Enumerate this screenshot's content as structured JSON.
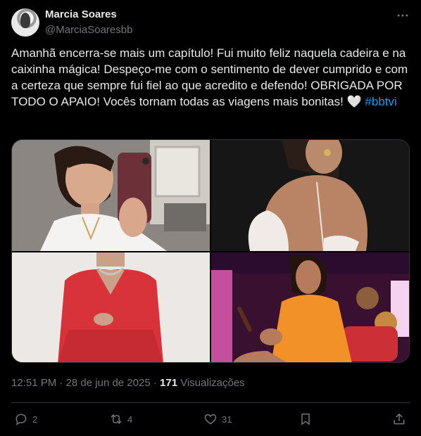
{
  "author": {
    "name": "Marcia Soares",
    "handle": "@MarciaSoaresbb"
  },
  "tweet": {
    "text": "Amanhã encerra-se mais um capítulo! Fui muito feliz naquela cadeira e na caixinha mágica! Despeço-me com o sentimento de dever cumprido e com a certeza que sempre fui fiel ao que acredito e defendo! OBRIGADA POR TODO O APAIO! Vocês tornam todas as viagens mais bonitas! 🤍 ",
    "hashtag": "#bbtvi"
  },
  "meta": {
    "time": "12:51 PM",
    "sep": " · ",
    "date": "28 de jun de 2025",
    "sep2": " · ",
    "views_count": "171",
    "views_label": " Visualizações"
  },
  "actions": {
    "replies": "2",
    "reposts": "4",
    "likes": "31"
  },
  "colors": {
    "background": "#000000",
    "text": "#e7e9ea",
    "muted": "#71767b",
    "accent": "#1d9bf0"
  }
}
